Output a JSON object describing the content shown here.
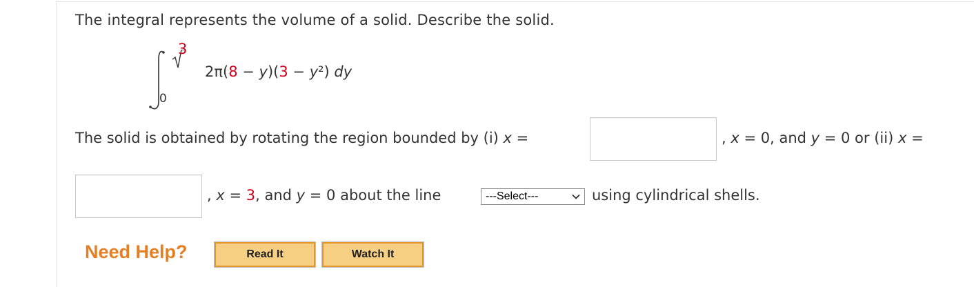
{
  "question": {
    "text": "The integral represents the volume of a solid. Describe the solid."
  },
  "integral": {
    "upper_radicand": "3",
    "lower": "0",
    "expr": [
      {
        "t": "2π(",
        "c": "plain"
      },
      {
        "t": "8",
        "c": "red"
      },
      {
        "t": " − ",
        "c": "plain"
      },
      {
        "t": "y",
        "c": "italic"
      },
      {
        "t": ")(",
        "c": "plain"
      },
      {
        "t": "3",
        "c": "red"
      },
      {
        "t": " − ",
        "c": "plain"
      },
      {
        "t": "y",
        "c": "italic"
      },
      {
        "t": "²) ",
        "c": "plain"
      },
      {
        "t": "dy",
        "c": "italic"
      }
    ]
  },
  "statement": {
    "line1_prefix": "The solid is obtained by rotating the region bounded by (i) ",
    "var_x": "x",
    "equals": " = ",
    "line1_mid_pre": ", ",
    "line1_mid_a": " = 0, and ",
    "var_y": "y",
    "line1_mid_b": " = 0 or (ii) ",
    "line2_pre": ", ",
    "line2_x_eq": " = ",
    "line2_x_val": "3",
    "line2_and": ", and ",
    "line2_about": " = 0 about the line ",
    "line2_suffix": "using cylindrical shells."
  },
  "inputs": {
    "box1_value": "",
    "box2_value": ""
  },
  "select": {
    "selected": "---Select---"
  },
  "help": {
    "label": "Need Help?",
    "read_label": "Read It",
    "watch_label": "Watch It"
  },
  "colors": {
    "accent_red": "#d0021b",
    "help_orange": "#e67e22",
    "button_fill": "#f7cf83"
  },
  "icons": {
    "select_arrow": "chevron-down-icon",
    "integral": "integral-sign-icon"
  }
}
